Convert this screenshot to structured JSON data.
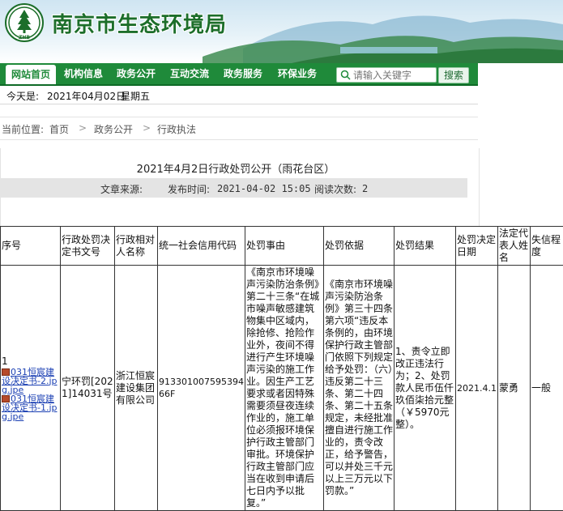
{
  "site": {
    "logo_text": "ZHB",
    "title": "南京市生态环境局"
  },
  "nav": {
    "items": [
      "网站首页",
      "机构信息",
      "政务公开",
      "互动交流",
      "政务服务",
      "环保业务"
    ],
    "search_placeholder": "请输入关键字",
    "search_button": "搜索"
  },
  "datebar": {
    "prefix": "今天是:",
    "date": "2021年04月02日",
    "weekday": "星期五"
  },
  "breadcrumb": {
    "prefix": "当前位置:",
    "items": [
      "首页",
      "政务公开",
      "行政执法"
    ],
    "separator": ">"
  },
  "article": {
    "title": "2021年4月2日行政处罚公开（雨花台区）",
    "source_label": "文章来源:",
    "source": "",
    "publish_label": "发布时间:",
    "publish_time": "2021-04-02 15:05",
    "views_label": "阅读次数:",
    "views": "2"
  },
  "table": {
    "headers": [
      "序号",
      "行政处罚决定书文号",
      "行政相对人名称",
      "统一社会信用代码",
      "处罚事由",
      "处罚依据",
      "处罚结果",
      "处罚决定日期",
      "法定代表人姓名",
      "失信程度"
    ],
    "rows": [
      {
        "index": "1",
        "attachments": [
          "031恒宸建设决定书-2.jpg.jpe",
          "031恒宸建设决定书-1.jpg.jpe"
        ],
        "doc_no": "宁环罚[2021]14031号",
        "party": "浙江恒宸建设集团有限公司",
        "credit_code": "91330100759539466F",
        "reason": "《南京市环境噪声污染防治条例》第二十三条“在城市噪声敏感建筑物集中区域内，除抢修、抢险作业外，夜间不得进行产生环境噪声污染的施工作业。因生产工艺要求或者因特殊需要须昼夜连续作业的，施工单位必须报环境保护行政主管部门审批。环境保护行政主管部门应当在收到申请后七日内予以批复。”",
        "basis": "《南京市环境噪声污染防治条例》第三十四条第六项“违反本条例的，由环境保护行政主管部门依照下列规定给予处罚：（六）违反第二十三条、第二十四条、第二十五条规定，未经批准擅自进行施工作业的，责令改正，给予警告，可以并处三千元以上三万元以下罚款。”",
        "result": "1、责令立即改正违法行为；2、处罚款人民币伍仟玖佰柒拾元整（￥5970元整）。",
        "date": "2021.4.1",
        "legal_rep": "蒙勇",
        "severity": "一般"
      }
    ]
  },
  "colors": {
    "nav_green": "#1f8a3a",
    "title_green": "#1c6e2a",
    "link_blue": "#1a3fb3"
  }
}
